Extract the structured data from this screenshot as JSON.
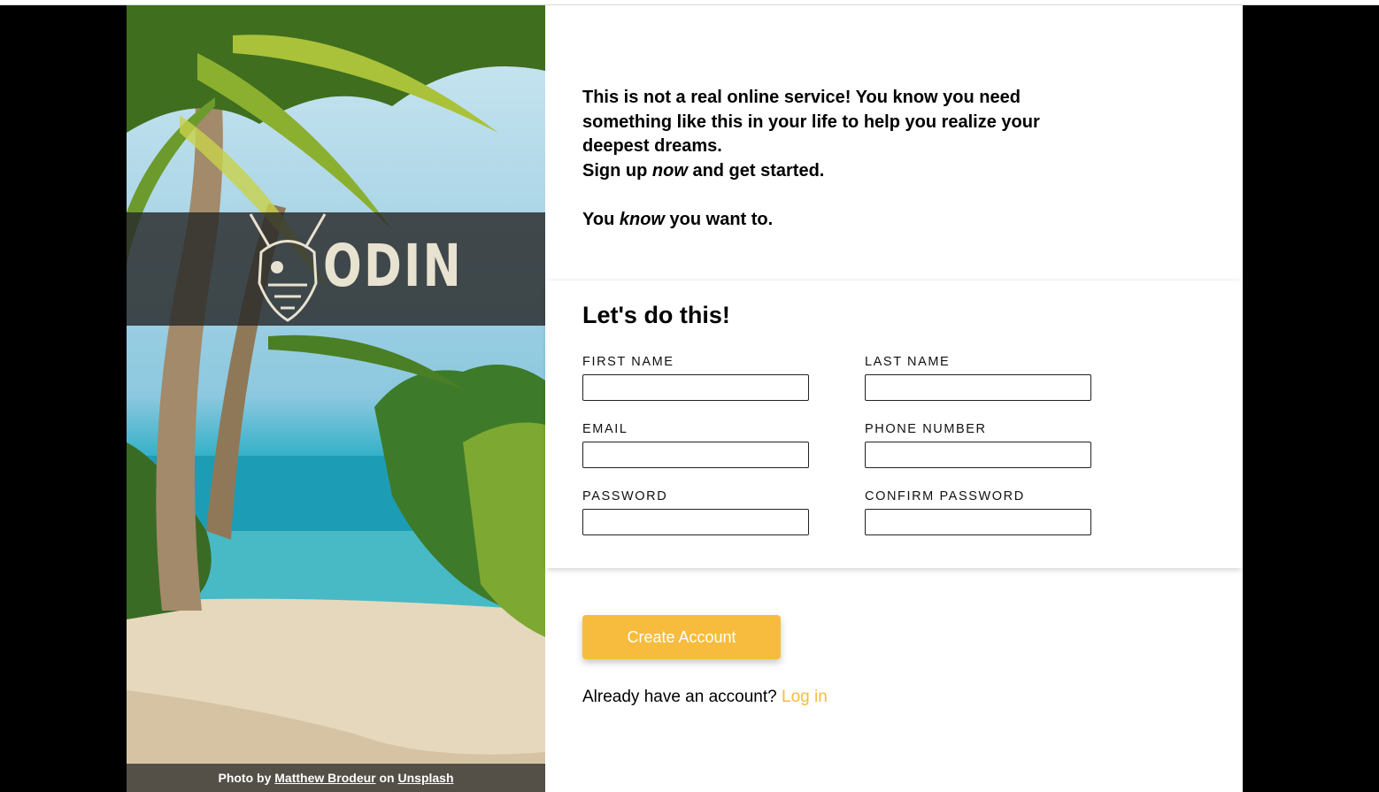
{
  "hero": {
    "logo_text": "ODIN",
    "credit_prefix": "Photo by",
    "credit_author": "Matthew Brodeur",
    "credit_on": "on",
    "credit_source": "Unsplash"
  },
  "intro": {
    "line1": "This is not a real online service! You know you need something like this in your life to help you realize your deepest dreams.",
    "line2_before": "Sign up ",
    "line2_em": "now",
    "line2_after": " and get started.",
    "line3_before": "You ",
    "line3_em": "know",
    "line3_after": " you want to."
  },
  "form": {
    "title": "Let's do this!",
    "fields": [
      {
        "label": "FIRST NAME",
        "value": ""
      },
      {
        "label": "LAST NAME",
        "value": ""
      },
      {
        "label": "EMAIL",
        "value": ""
      },
      {
        "label": "PHONE NUMBER",
        "value": ""
      },
      {
        "label": "PASSWORD",
        "value": ""
      },
      {
        "label": "CONFIRM PASSWORD",
        "value": ""
      }
    ]
  },
  "submit_label": "Create Account",
  "login": {
    "prompt": "Already have an account?",
    "link": "Log in"
  },
  "colors": {
    "accent": "#f7bc3e",
    "logo_band": "#282828"
  }
}
